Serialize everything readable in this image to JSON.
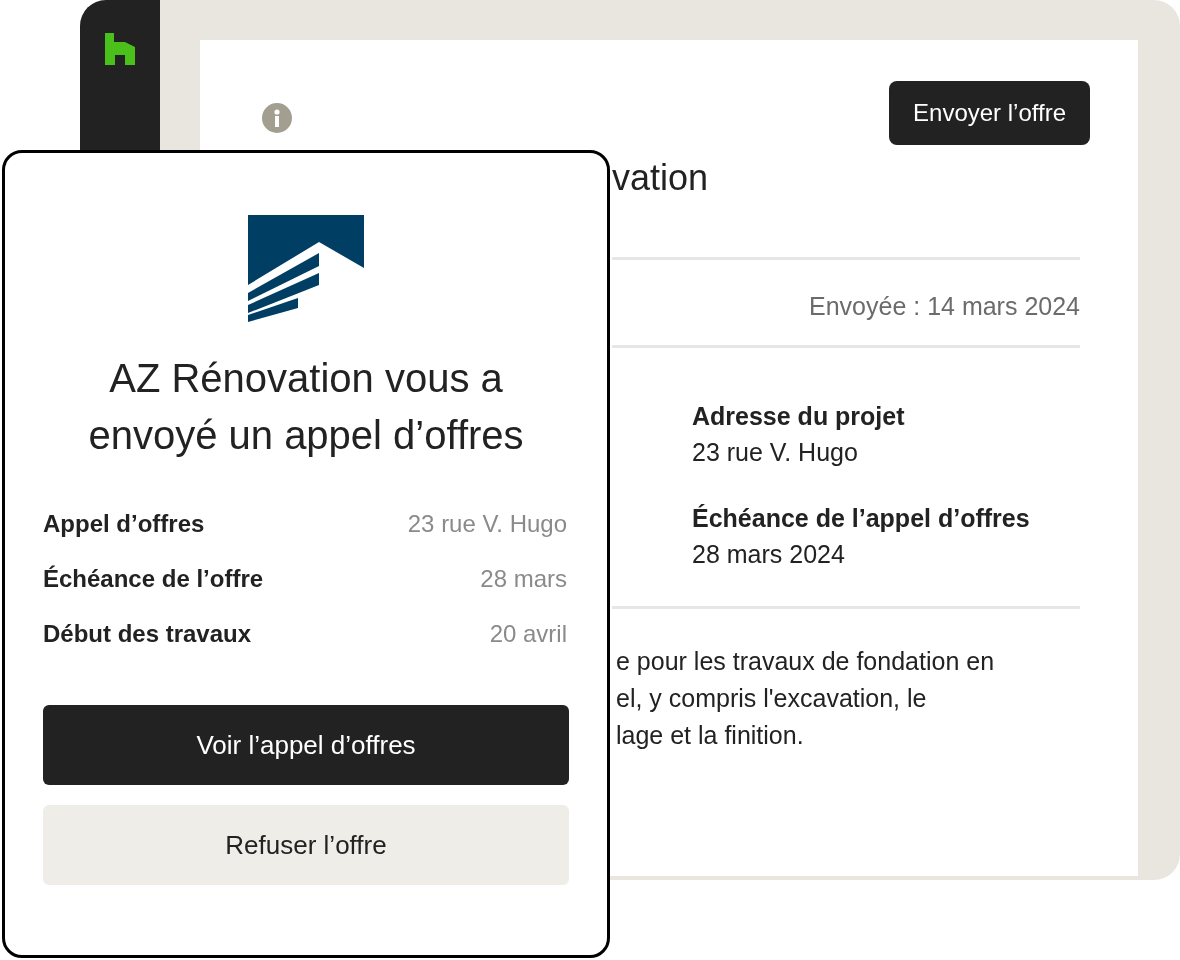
{
  "app_window": {
    "send_button": "Envoyer l’offre",
    "title_fragment": "vation",
    "sent_date": "Envoyée : 14 mars 2024",
    "details": [
      {
        "label": "Adresse du projet",
        "value": "23 rue V. Hugo"
      },
      {
        "label": "Échéance de l’appel d’offres",
        "value": "28 mars 2024"
      }
    ],
    "description_lines": [
      "e pour les travaux de fondation en",
      "el, y compris l'excavation, le",
      "lage et la finition."
    ]
  },
  "invitation_card": {
    "title": "AZ Rénovation vous a envoyé un appel d’offres",
    "rows": [
      {
        "label": "Appel d’offres",
        "value": "23 rue V. Hugo"
      },
      {
        "label": "Échéance de l’offre",
        "value": "28 mars"
      },
      {
        "label": "Début des travaux",
        "value": "20 avril"
      }
    ],
    "primary_button": "Voir l’appel d’offres",
    "secondary_button": "Refuser l’offre"
  }
}
